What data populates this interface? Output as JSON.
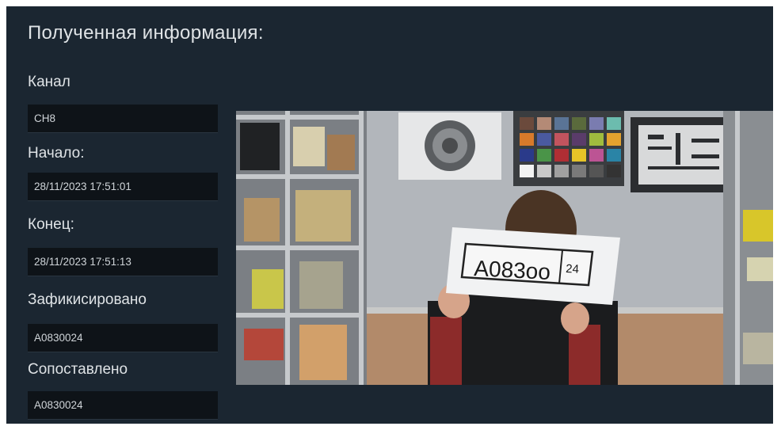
{
  "panel": {
    "title": "Полученная информация:"
  },
  "fields": [
    {
      "label": "Канал",
      "value": "CH8"
    },
    {
      "label": "Начало:",
      "value": "28/11/2023 17:51:01"
    },
    {
      "label": "Конец:",
      "value": "28/11/2023 17:51:13"
    },
    {
      "label": "Зафикисировано",
      "value": "A0830024"
    },
    {
      "label": "Сопоставлено",
      "value": "A0830024"
    }
  ],
  "snapshot": {
    "plate_text": "A083oo",
    "plate_region": "24"
  },
  "colors": {
    "background": "#1b2631",
    "field_background": "#0e1318",
    "text": "#dfe3e6"
  }
}
